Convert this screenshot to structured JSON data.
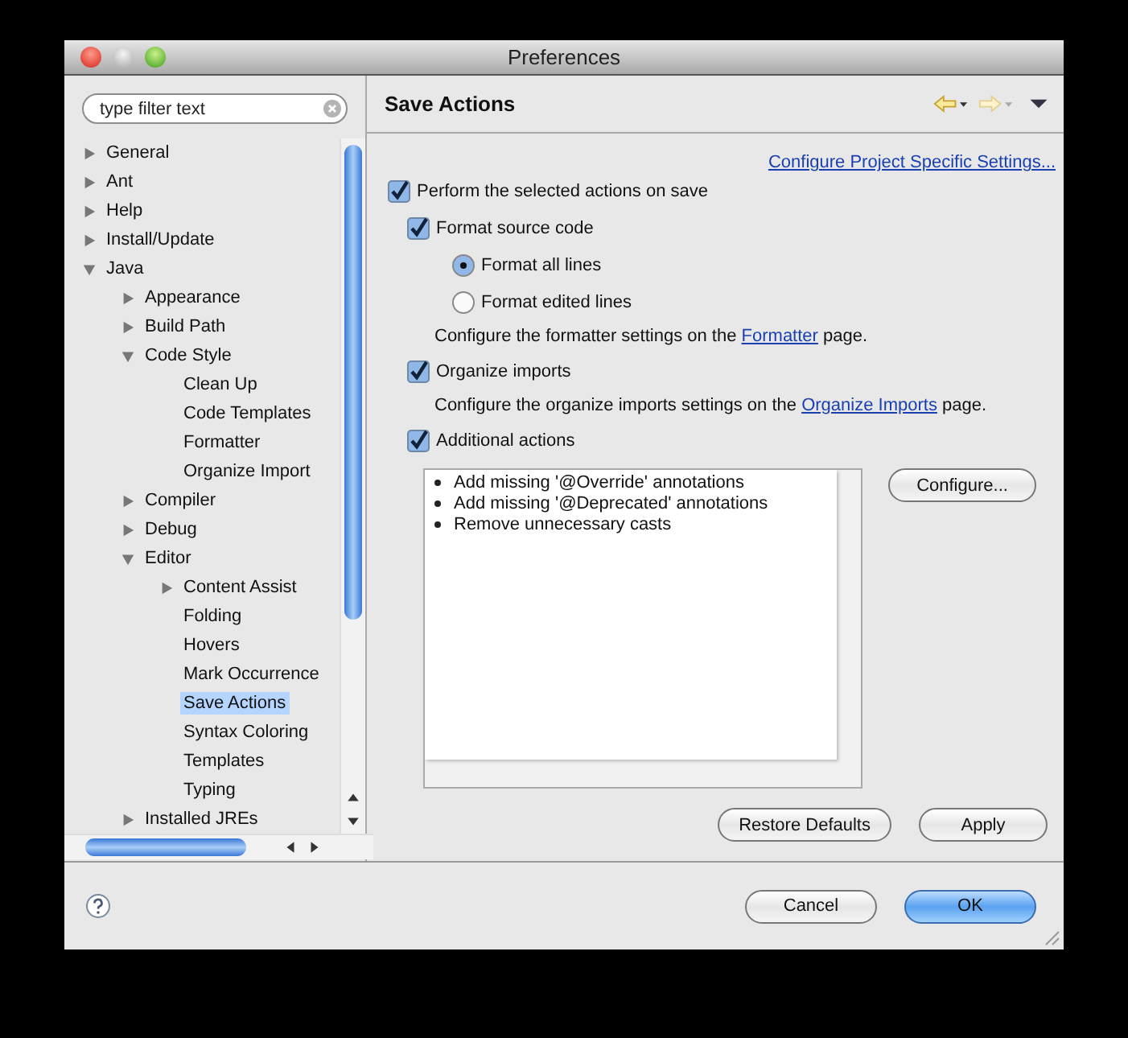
{
  "window": {
    "title": "Preferences"
  },
  "filter": {
    "placeholder": "type filter text"
  },
  "tree": {
    "items": [
      {
        "label": "General",
        "expanded": false,
        "selected": false
      },
      {
        "label": "Ant",
        "expanded": false,
        "selected": false
      },
      {
        "label": "Help",
        "expanded": false,
        "selected": false
      },
      {
        "label": "Install/Update",
        "expanded": false,
        "selected": false
      },
      {
        "label": "Java",
        "expanded": true,
        "selected": false,
        "children": [
          {
            "label": "Appearance",
            "expanded": false,
            "selected": false
          },
          {
            "label": "Build Path",
            "expanded": false,
            "selected": false
          },
          {
            "label": "Code Style",
            "expanded": true,
            "selected": false,
            "children": [
              {
                "label": "Clean Up",
                "selected": false
              },
              {
                "label": "Code Templates",
                "selected": false
              },
              {
                "label": "Formatter",
                "selected": false
              },
              {
                "label": "Organize Import",
                "selected": false
              }
            ]
          },
          {
            "label": "Compiler",
            "expanded": false,
            "selected": false
          },
          {
            "label": "Debug",
            "expanded": false,
            "selected": false
          },
          {
            "label": "Editor",
            "expanded": true,
            "selected": false,
            "children": [
              {
                "label": "Content Assist",
                "expanded": false,
                "selected": false
              },
              {
                "label": "Folding",
                "selected": false
              },
              {
                "label": "Hovers",
                "selected": false
              },
              {
                "label": "Mark Occurrence",
                "selected": false
              },
              {
                "label": "Save Actions",
                "selected": true
              },
              {
                "label": "Syntax Coloring",
                "selected": false
              },
              {
                "label": "Templates",
                "selected": false
              },
              {
                "label": "Typing",
                "selected": false
              }
            ]
          },
          {
            "label": "Installed JREs",
            "expanded": false,
            "selected": false
          }
        ]
      }
    ]
  },
  "page": {
    "title": "Save Actions",
    "project_link": "Configure Project Specific Settings...",
    "options": [
      {
        "kind": "checkbox",
        "label": "Perform the selected actions on save",
        "checked": true,
        "children": [
          {
            "kind": "checkbox",
            "label": "Format source code",
            "checked": true,
            "children": [
              {
                "kind": "radio",
                "label": "Format all lines",
                "selected": true
              },
              {
                "kind": "radio",
                "label": "Format edited lines",
                "selected": false
              }
            ]
          },
          {
            "kind": "note",
            "before": "Configure the formatter settings on the ",
            "link": "Formatter",
            "after": " page."
          },
          {
            "kind": "checkbox",
            "label": "Organize imports",
            "checked": true
          },
          {
            "kind": "note",
            "before": "Configure the organize imports settings on the ",
            "link": "Organize Imports",
            "after": " page."
          },
          {
            "kind": "checkbox",
            "label": "Additional actions",
            "checked": true
          }
        ]
      }
    ],
    "actions": [
      "Add missing '@Override' annotations",
      "Add missing '@Deprecated' annotations",
      "Remove unnecessary casts"
    ],
    "configure_button": "Configure...",
    "restore_button": "Restore Defaults",
    "apply_button": "Apply"
  },
  "buttons": [
    {
      "label": "Cancel",
      "default": false
    },
    {
      "label": "OK",
      "default": true
    }
  ]
}
